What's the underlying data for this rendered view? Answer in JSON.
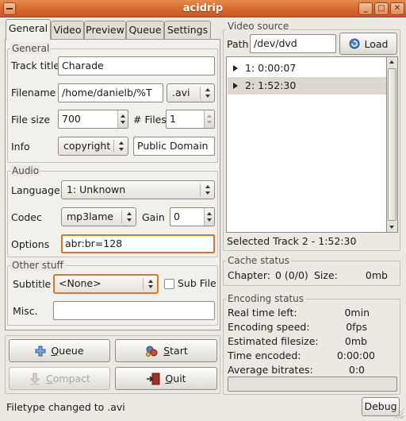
{
  "window": {
    "title": "acidrip",
    "controls": [
      "_",
      "□",
      "✕"
    ]
  },
  "tabs": [
    "General",
    "Video",
    "Preview",
    "Queue",
    "Settings"
  ],
  "general_frame": {
    "label": "General",
    "track_title_label": "Track title",
    "track_title_value": "Charade",
    "filename_label": "Filename",
    "filename_value": "/home/danielb/%T",
    "extension_value": ".avi",
    "filesize_label": "File size",
    "filesize_value": "700",
    "files_label": "# Files",
    "files_value": "1",
    "info_label": "Info",
    "info_select": "copyright",
    "info_value": "Public Domain"
  },
  "audio_frame": {
    "label": "Audio",
    "language_label": "Language",
    "language_value": "1: Unknown",
    "codec_label": "Codec",
    "codec_value": "mp3lame",
    "gain_label": "Gain",
    "gain_value": "0",
    "options_label": "Options",
    "options_value": "abr:br=128"
  },
  "other_frame": {
    "label": "Other stuff",
    "subtitle_label": "Subtitle",
    "subtitle_value": "<None>",
    "subfile_label": "Sub File",
    "misc_label": "Misc.",
    "misc_value": ""
  },
  "buttons": {
    "queue_prefix": "",
    "queue_mnemonic": "Q",
    "queue_rest": "ueue",
    "start_mnemonic": "S",
    "start_rest": "tart",
    "compact_prefix": "",
    "compact_mnemonic": "C",
    "compact_rest": "ompact",
    "quit_mnemonic": "Q",
    "quit_rest": "uit"
  },
  "video_source": {
    "label": "Video source",
    "path_label": "Path",
    "path_value": "/dev/dvd",
    "load_label": "Load",
    "tracks": [
      {
        "label": "1: 0:00:07",
        "selected": false
      },
      {
        "label": "2: 1:52:30",
        "selected": true
      }
    ],
    "selected_text": "Selected Track 2 - 1:52:30"
  },
  "cache_status": {
    "label": "Cache status",
    "chapter_label": "Chapter:",
    "chapter_value": "0 (0/0)",
    "size_label": "Size:",
    "size_value": "0mb"
  },
  "encoding_status": {
    "label": "Encoding status",
    "rows": [
      {
        "label": "Real time left:",
        "value": "0min"
      },
      {
        "label": "Encoding speed:",
        "value": "0fps"
      },
      {
        "label": "Estimated filesize:",
        "value": "0mb"
      },
      {
        "label": "Time encoded:",
        "value": "0:00:00"
      },
      {
        "label": "Average bitrates:",
        "value": "0:0"
      }
    ],
    "progress": 0
  },
  "status_bar": {
    "text": "Filetype changed to .avi",
    "debug_label": "Debug"
  }
}
